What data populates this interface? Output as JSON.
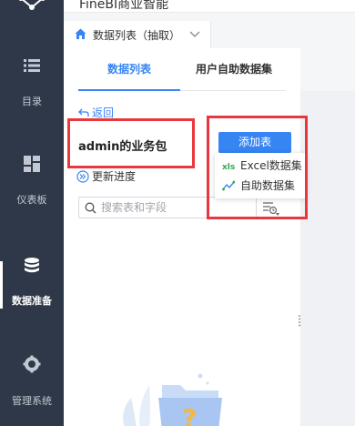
{
  "app": {
    "title": "FineBI商业智能"
  },
  "sidebar": {
    "items": [
      {
        "label": "目录",
        "icon": "list-icon"
      },
      {
        "label": "仪表板",
        "icon": "dashboard-icon"
      },
      {
        "label": "数据准备",
        "icon": "database-icon",
        "active": true
      },
      {
        "label": "管理系统",
        "icon": "gear-icon"
      }
    ]
  },
  "breadcrumb": {
    "label": "数据列表（抽取）"
  },
  "tabs": [
    {
      "label": "数据列表",
      "active": true
    },
    {
      "label": "用户自助数据集",
      "active": false
    }
  ],
  "panel": {
    "back_label": "返回",
    "package_name": "admin的业务包",
    "update_label": "更新进度",
    "search_placeholder": "搜索表和字段"
  },
  "add_table": {
    "label": "添加表",
    "menu": [
      {
        "label": "Excel数据集",
        "icon": "excel-icon"
      },
      {
        "label": "自助数据集",
        "icon": "self-service-dataset-icon"
      }
    ]
  },
  "colors": {
    "accent": "#3685f2",
    "sidebar_bg": "#2f3848",
    "highlight": "#e8383d"
  }
}
